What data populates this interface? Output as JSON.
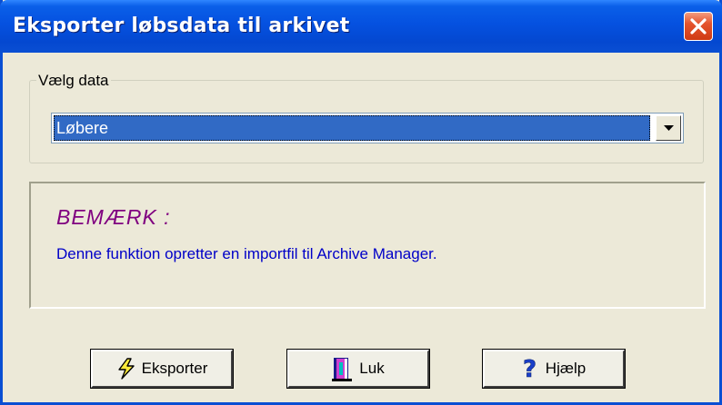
{
  "window": {
    "title": "Eksporter løbsdata til arkivet"
  },
  "group": {
    "legend": "Vælg data",
    "combo_value": "Løbere"
  },
  "note": {
    "title": "BEMÆRK :",
    "text": "Denne funktion opretter en importfil til Archive Manager."
  },
  "buttons": {
    "export_label": "Eksporter",
    "close_label": "Luk",
    "help_label": "Hjælp"
  },
  "icons": {
    "close": "close-icon",
    "dropdown": "chevron-down-icon",
    "export": "lightning-icon",
    "luk": "door-exit-icon",
    "help": "question-mark-icon"
  },
  "colors": {
    "titlebar": "#0a4fd3",
    "selection": "#316ac5",
    "note_title": "#800080",
    "note_text": "#0000c8"
  }
}
